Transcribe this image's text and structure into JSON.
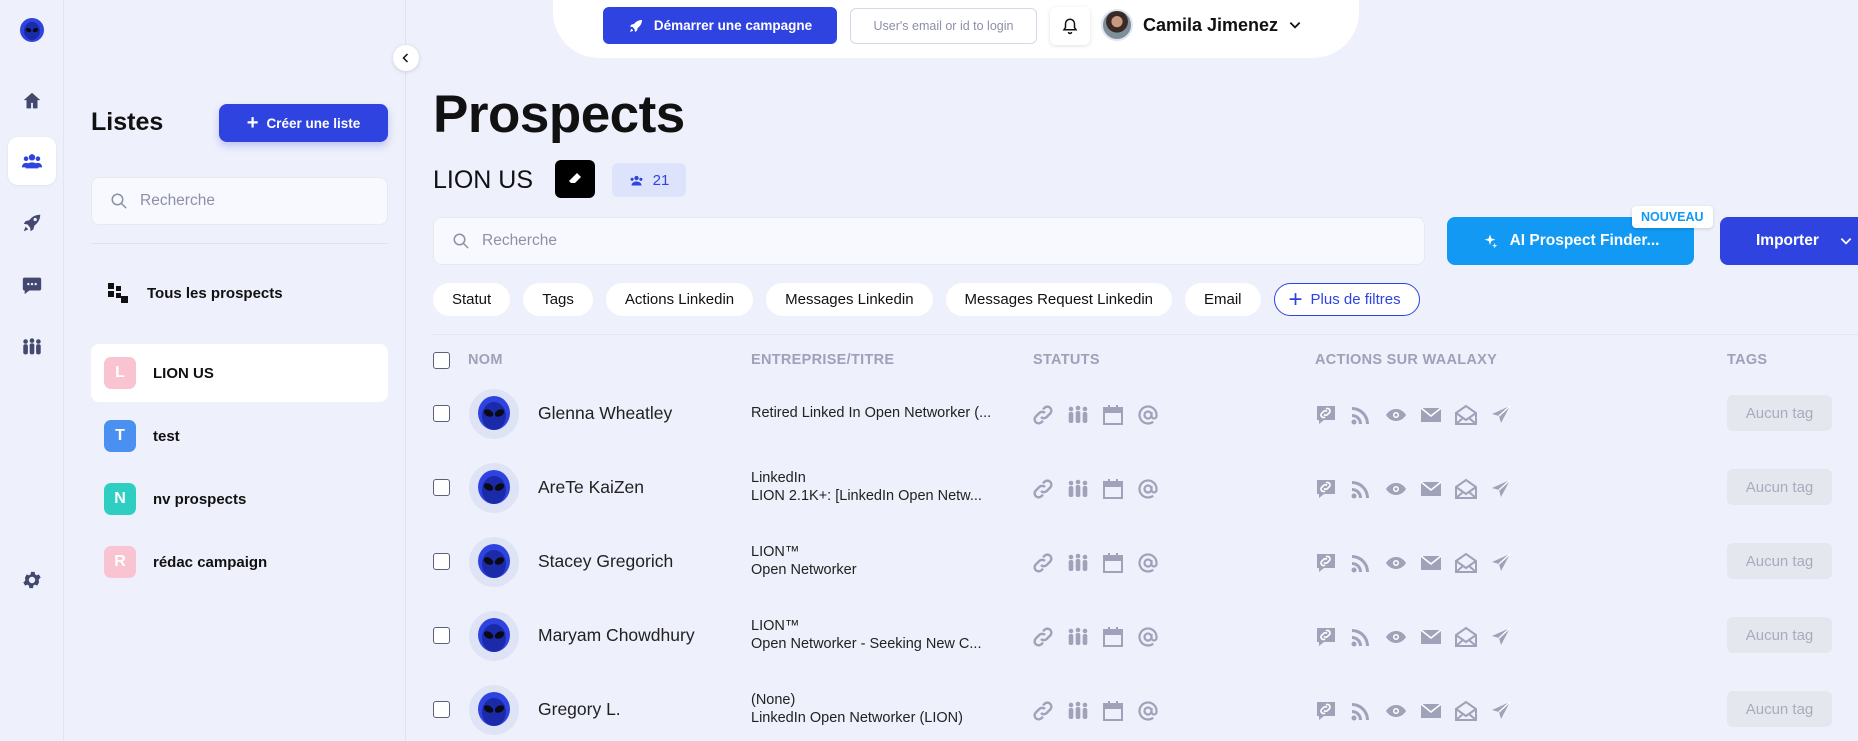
{
  "topbar": {
    "campaign_label": "Démarrer une campagne",
    "login_placeholder": "User's email or id to login",
    "user_name": "Camila Jimenez"
  },
  "lists_panel": {
    "title": "Listes",
    "create_label": "Créer une liste",
    "search_placeholder": "Recherche",
    "all_label": "Tous les prospects",
    "items": [
      {
        "letter": "L",
        "label": "LION US",
        "color": "#f9c3d2",
        "active": true
      },
      {
        "letter": "T",
        "label": "test",
        "color": "#4a90f0",
        "active": false
      },
      {
        "letter": "N",
        "label": "nv prospects",
        "color": "#2ecfc2",
        "active": false
      },
      {
        "letter": "R",
        "label": "rédac campaign",
        "color": "#f9c3d2",
        "active": false
      }
    ]
  },
  "main": {
    "title": "Prospects",
    "list_name": "LION US",
    "count": "21",
    "search_placeholder": "Recherche",
    "ai_label": "AI Prospect Finder...",
    "new_badge": "NOUVEAU",
    "import_label": "Importer",
    "filters": [
      "Statut",
      "Tags",
      "Actions Linkedin",
      "Messages Linkedin",
      "Messages Request Linkedin",
      "Email"
    ],
    "more_filters": "Plus de filtres"
  },
  "table": {
    "headers": {
      "name": "NOM",
      "company": "ENTREPRISE/TITRE",
      "status": "STATUTS",
      "actions": "ACTIONS SUR WAALAXY",
      "tags": "TAGS"
    },
    "rows": [
      {
        "name": "Glenna Wheatley",
        "company_lines": [
          "Retired Linked In Open Networker (..."
        ],
        "tag": "Aucun tag"
      },
      {
        "name": "AreTe KaiZen",
        "company_lines": [
          "LinkedIn",
          "LION 2.1K+: [LinkedIn Open Netw..."
        ],
        "tag": "Aucun tag"
      },
      {
        "name": "Stacey Gregorich",
        "company_lines": [
          "LION™",
          "Open Networker"
        ],
        "tag": "Aucun tag"
      },
      {
        "name": "Maryam Chowdhury",
        "company_lines": [
          "LION™",
          "Open Networker - Seeking New C..."
        ],
        "tag": "Aucun tag"
      },
      {
        "name": "Gregory L.",
        "company_lines": [
          "(None)",
          "LinkedIn Open Networker (LION)"
        ],
        "tag": "Aucun tag"
      }
    ]
  },
  "colors": {
    "accent": "#2f43e0",
    "ai_blue": "#1199f3",
    "background": "#eef0fb"
  }
}
